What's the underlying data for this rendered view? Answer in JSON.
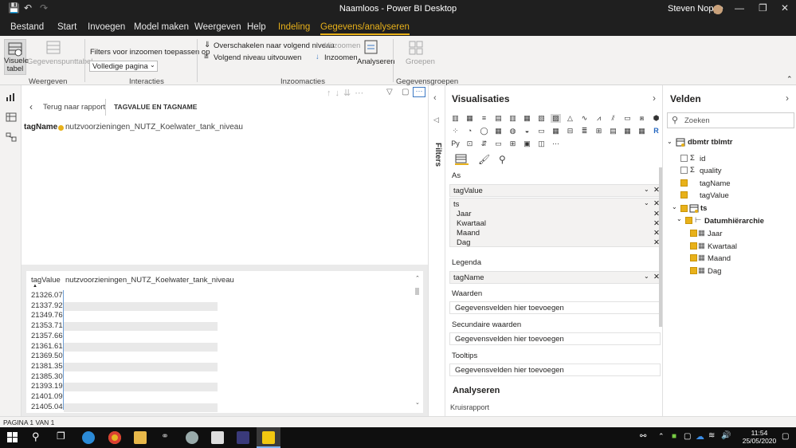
{
  "window": {
    "title": "Naamloos - Power BI Desktop",
    "user": "Steven Noppe"
  },
  "tabs": [
    "Bestand",
    "Start",
    "Invoegen",
    "Model maken",
    "Weergeven",
    "Help",
    "Indeling",
    "Gegevens/analyseren"
  ],
  "ribbon": {
    "visual_table": "Visuele tabel",
    "datapoint_table": "Gegevenspunttabel",
    "group_view": "Weergeven",
    "filter_label": "Filters voor inzoomen toepassen op",
    "filter_value": "Volledige pagina",
    "group_interactions": "Interacties",
    "next_level": "Overschakelen naar volgend niveau",
    "expand_next": "Volgend niveau uitvouwen",
    "zoom_out": "Uitzoomen",
    "zoom_in": "Inzoomen",
    "analyze": "Analyseren",
    "group_zoom": "Inzoomacties",
    "groups": "Groepen",
    "group_data": "Gegevensgroepen"
  },
  "report": {
    "back": "Terug naar rapport",
    "title": "TAGVALUE EN TAGNAME",
    "legend_label": "tagName",
    "legend_item": "nutzvoorzieningen_NUTZ_Koelwater_tank_niveau",
    "col1": "tagValue",
    "col2": "nutzvoorzieningen_NUTZ_Koelwater_tank_niveau",
    "rows": [
      "21326.07",
      "21337.92",
      "21349.76",
      "21353.71",
      "21357.66",
      "21361.61",
      "21369.50",
      "21381.35",
      "21385.30",
      "21393.19",
      "21401.09",
      "21405.04"
    ]
  },
  "filters_label": "Filters",
  "viz": {
    "title": "Visualisaties",
    "as_label": "As",
    "as_field": "tagValue",
    "ts_field": "ts",
    "ts_sub": [
      "Jaar",
      "Kwartaal",
      "Maand",
      "Dag"
    ],
    "legend_label": "Legenda",
    "legend_field": "tagName",
    "values_label": "Waarden",
    "values_placeholder": "Gegevensvelden hier toevoegen",
    "secondary_label": "Secundaire waarden",
    "secondary_placeholder": "Gegevensvelden hier toevoegen",
    "tooltips_label": "Tooltips",
    "tooltips_placeholder": "Gegevensvelden hier toevoegen",
    "analyze_label": "Analyseren",
    "cross_report": "Kruisrapport"
  },
  "fields": {
    "title": "Velden",
    "search_placeholder": "Zoeken",
    "table_name": "dbmtr tblmtr",
    "items": [
      "id",
      "quality",
      "tagName",
      "tagValue"
    ],
    "ts": "ts",
    "hierarchy": "Datumhiërarchie",
    "hier_items": [
      "Jaar",
      "Kwartaal",
      "Maand",
      "Dag"
    ]
  },
  "status": {
    "page": "PAGINA 1 VAN 1",
    "time": "11:54",
    "date": "25/05/2020"
  },
  "colors": {
    "accent": "#e8b11a",
    "titlebar": "#1f1f1f"
  }
}
